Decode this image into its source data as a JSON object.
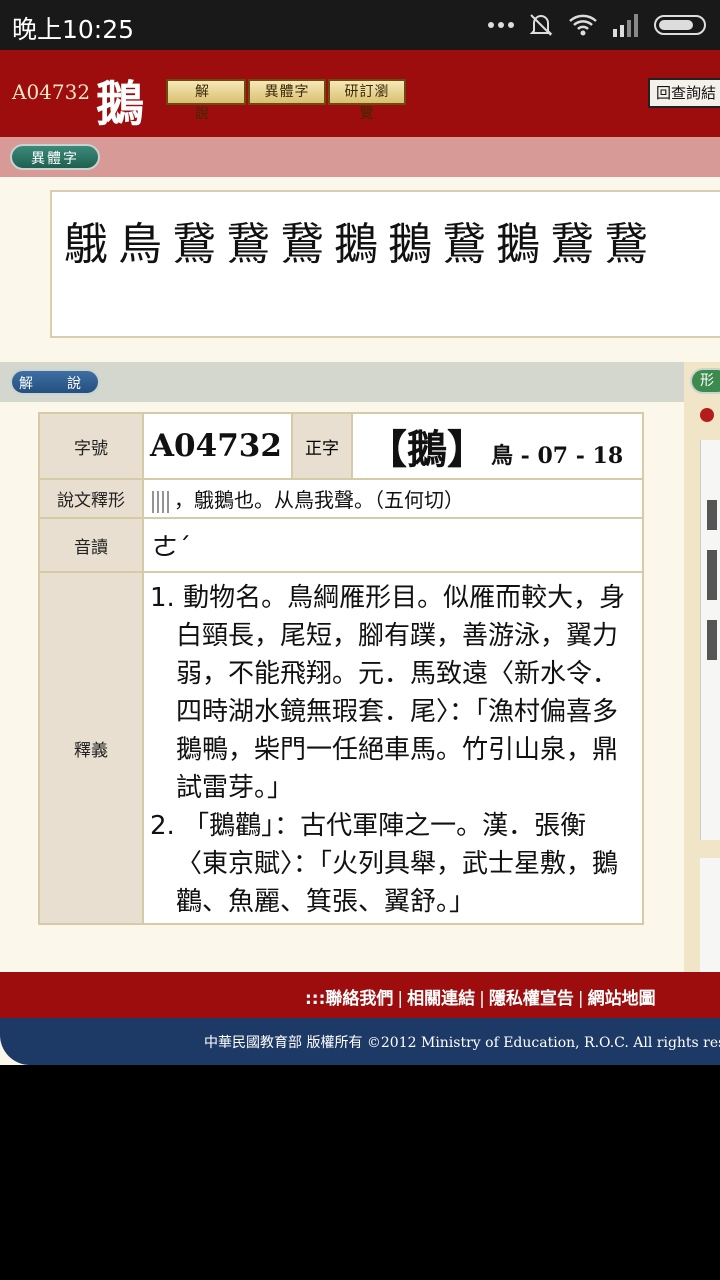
{
  "status_bar": {
    "time": "晚上10:25"
  },
  "header": {
    "code": "A04732",
    "char": "鵝",
    "tabs": [
      "解　說",
      "異體字",
      "研訂瀏覽"
    ],
    "back_button": "回查詢結"
  },
  "variant_section": {
    "label": "異體字",
    "variants": [
      "䳘",
      "鳥",
      "鵞",
      "鵞",
      "鵞",
      "鵝",
      "鵝",
      "鵞",
      "鵝",
      "鵞",
      "鵞"
    ]
  },
  "explain_section": {
    "label": "解　說",
    "side_tab": "形"
  },
  "info_table": {
    "id_label": "字號",
    "id_value": "A04732",
    "zhengzi_label": "正字",
    "zhengzi_char": "【鵝】",
    "zhengzi_radical": "鳥 - 07 - 18",
    "shuowen_label": "說文釋形",
    "shuowen_text": "，䳘鵝也。从鳥我聲。（五何切）",
    "yindu_label": "音讀",
    "yindu_value": "ㄜˊ",
    "shiyi_label": "釋義",
    "definitions": [
      "1. 動物名。鳥綱雁形目。似雁而較大，身白頸長，尾短，腳有蹼，善游泳，翼力弱，不能飛翔。元．馬致遠〈新水令．四時湖水鏡無瑕套．尾〉：「漁村偏喜多鵝鴨，柴門一任絕車馬。竹引山泉，鼎試雷芽。」",
      "2. 「鵝鸛」：古代軍陣之一。漢．張衡〈東京賦〉：「火列具舉，武士星敷，鵝鸛、魚麗、箕張、翼舒。」"
    ]
  },
  "footer": {
    "links": [
      ":::聯絡我們",
      "相關連結",
      "隱私權宣告",
      "網站地圖"
    ],
    "copyright": "中華民國教育部 版權所有 ©2012 Ministry of Education, R.O.C. All rights res"
  }
}
